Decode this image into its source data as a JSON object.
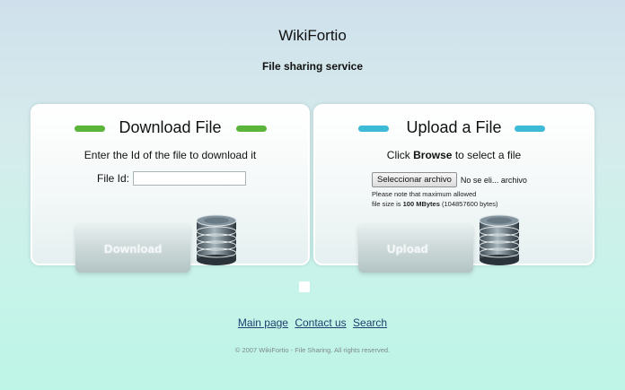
{
  "header": {
    "title": "WikiFortio",
    "tagline": "File sharing service"
  },
  "download": {
    "title": "Download File",
    "description": "Enter the Id of the file to download it",
    "field_label": "File Id:",
    "field_value": "",
    "button_label": "Download",
    "accent_color": "#5ab53a"
  },
  "upload": {
    "title": "Upload a File",
    "desc_prefix": "Click",
    "desc_bold": "Browse",
    "desc_suffix": "to select a file",
    "browse_button": "Seleccionar archivo",
    "browse_status": "No se eli... archivo",
    "note_line1": "Please note that maximum allowed",
    "note_prefix": "file size is",
    "note_bold": "100 MBytes",
    "note_suffix": "(104857600 bytes)",
    "button_label": "Upload",
    "accent_color": "#3cbad6"
  },
  "footer": {
    "links": [
      "Main page",
      "Contact us",
      "Search"
    ],
    "copyright": "© 2007 WikiFortio - File Sharing. All rights reserved."
  },
  "icons": {
    "disk": "disk-stack-icon",
    "square": "square-icon"
  }
}
